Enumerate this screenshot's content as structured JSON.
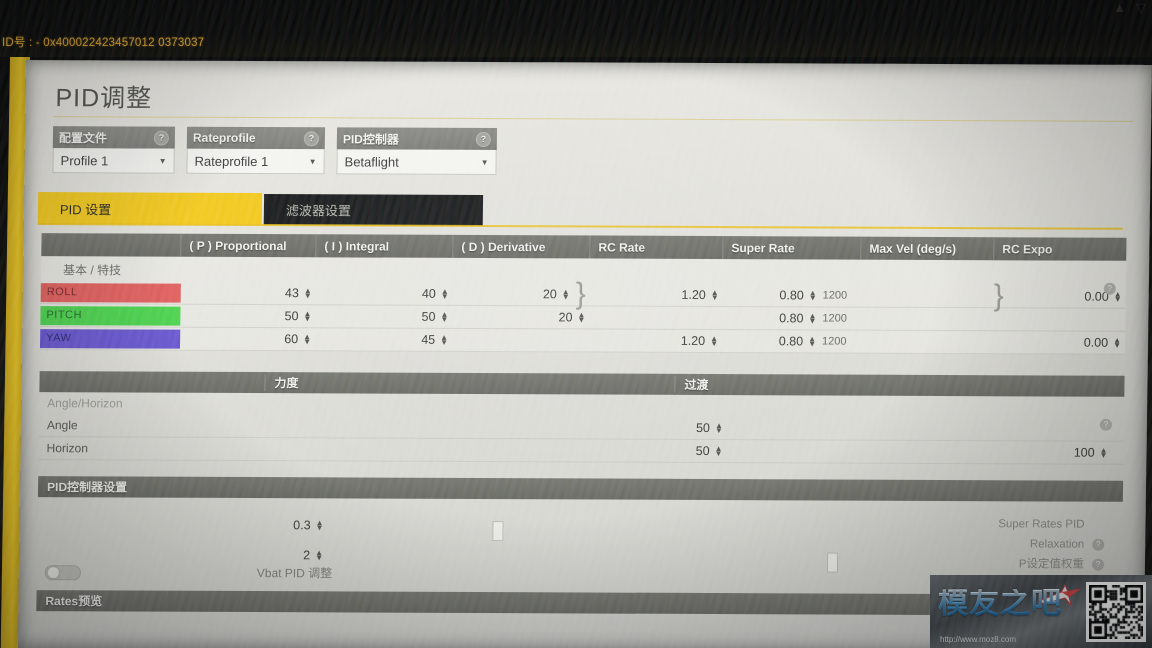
{
  "os_bar": {
    "id_label": "ID号",
    "id_value": ": - 0x400022423457012 0373037",
    "tray_icons": [
      "warning-icon",
      "network-icon"
    ]
  },
  "app": {
    "page_title": "PID调整",
    "selectors": [
      {
        "name": "profile",
        "header": "配置文件",
        "value": "Profile 1",
        "help": "?"
      },
      {
        "name": "rateprofile",
        "header": "Rateprofile",
        "value": "Rateprofile 1",
        "help": "?"
      },
      {
        "name": "pidcontroller",
        "header": "PID控制器",
        "value": "Betaflight",
        "help": "?"
      }
    ],
    "tabs": [
      {
        "label": "PID 设置",
        "active": true
      },
      {
        "label": "滤波器设置",
        "active": false
      }
    ],
    "pid_table": {
      "headers": [
        "",
        "( P ) Proportional",
        "( I ) Integral",
        "( D ) Derivative",
        "RC Rate",
        "Super Rate",
        "Max Vel (deg/s)",
        "RC Expo"
      ],
      "section_label": "基本 / 特技",
      "rows": [
        {
          "axis": "ROLL",
          "color": "#e0605e",
          "p": "43",
          "i": "40",
          "d": "20",
          "rc_rate": "1.20",
          "super_rate": "0.80",
          "max_vel": "1200",
          "rc_expo": "0.00"
        },
        {
          "axis": "PITCH",
          "color": "#4ed24e",
          "p": "50",
          "i": "50",
          "d": "20",
          "rc_rate": "",
          "super_rate": "0.80",
          "max_vel": "1200",
          "rc_expo": ""
        },
        {
          "axis": "YAW",
          "color": "#6a57cf",
          "p": "60",
          "i": "45",
          "d": "",
          "rc_rate": "1.20",
          "super_rate": "0.80",
          "max_vel": "1200",
          "rc_expo": "0.00"
        }
      ]
    },
    "angle_section": {
      "col_strength": "力度",
      "col_transition": "过渡",
      "group_label": "Angle/Horizon",
      "rows": [
        {
          "label": "Angle",
          "strength": "50",
          "transition": ""
        },
        {
          "label": "Horizon",
          "strength": "50",
          "transition": "100"
        }
      ]
    },
    "pid_settings": {
      "header": "PID控制器设置",
      "value_1": "0.3",
      "value_2": "2",
      "vbat_label": "Vbat PID 调整",
      "right_notes": [
        "Super Rates PID",
        "Relaxation",
        "P设定值权重"
      ]
    },
    "rates_preview": {
      "header": "Rates预览"
    }
  },
  "watermark": {
    "text": "模友之吧",
    "url": "http://www.moz8.com"
  }
}
